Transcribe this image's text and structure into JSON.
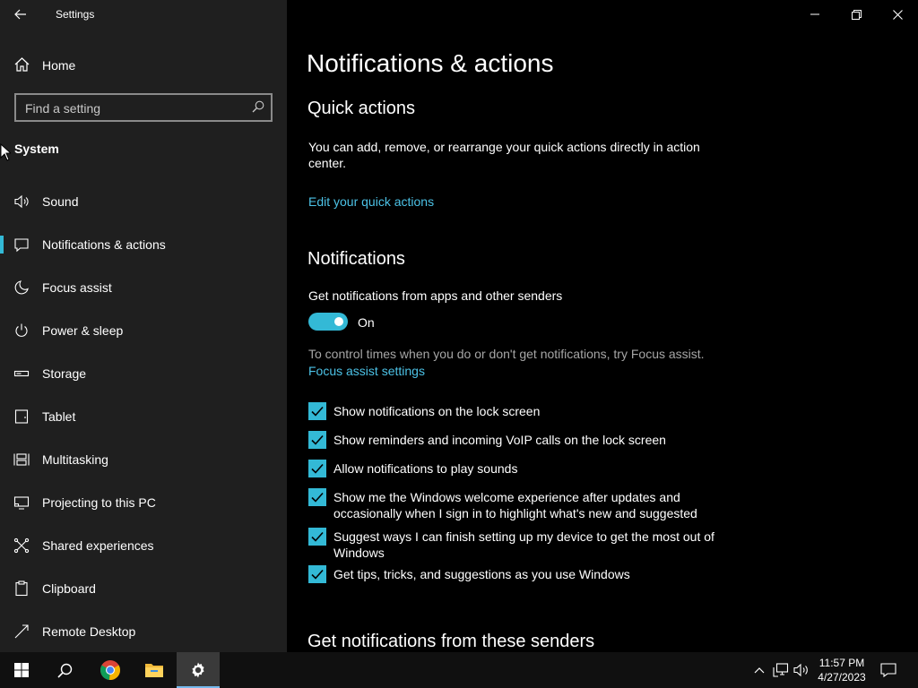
{
  "window": {
    "title": "Settings"
  },
  "sidebar": {
    "home_label": "Home",
    "search_placeholder": "Find a setting",
    "section_title": "System",
    "items": [
      {
        "label": "Sound",
        "icon": "speaker-icon"
      },
      {
        "label": "Notifications & actions",
        "icon": "speech-bubble-icon",
        "selected": true
      },
      {
        "label": "Focus assist",
        "icon": "moon-icon"
      },
      {
        "label": "Power & sleep",
        "icon": "power-icon"
      },
      {
        "label": "Storage",
        "icon": "storage-drive-icon"
      },
      {
        "label": "Tablet",
        "icon": "tablet-icon"
      },
      {
        "label": "Multitasking",
        "icon": "multitasking-icon"
      },
      {
        "label": "Projecting to this PC",
        "icon": "projecting-icon"
      },
      {
        "label": "Shared experiences",
        "icon": "shared-experiences-icon"
      },
      {
        "label": "Clipboard",
        "icon": "clipboard-icon"
      },
      {
        "label": "Remote Desktop",
        "icon": "remote-desktop-icon"
      }
    ]
  },
  "main": {
    "page_title": "Notifications & actions",
    "quick_actions": {
      "heading": "Quick actions",
      "description": "You can add, remove, or rearrange your quick actions directly in action center.",
      "link": "Edit your quick actions"
    },
    "notifications": {
      "heading": "Notifications",
      "toggle_label": "Get notifications from apps and other senders",
      "toggle_state": "On",
      "toggle_on": true,
      "focus_hint": "To control times when you do or don't get notifications, try Focus assist.",
      "focus_link": "Focus assist settings",
      "checkboxes": [
        {
          "label": "Show notifications on the lock screen",
          "checked": true
        },
        {
          "label": "Show reminders and incoming VoIP calls on the lock screen",
          "checked": true
        },
        {
          "label": "Allow notifications to play sounds",
          "checked": true
        },
        {
          "label": "Show me the Windows welcome experience after updates and occasionally when I sign in to highlight what's new and suggested",
          "checked": true
        },
        {
          "label": "Suggest ways I can finish setting up my device to get the most out of Windows",
          "checked": true
        },
        {
          "label": "Get tips, tricks, and suggestions as you use Windows",
          "checked": true
        }
      ]
    },
    "senders_heading": "Get notifications from these senders"
  },
  "taskbar": {
    "time": "11:57 PM",
    "date": "4/27/2023",
    "pinned": [
      "windows-start-icon",
      "search-icon",
      "chrome-icon",
      "file-explorer-icon",
      "settings-gear-icon"
    ],
    "tray": [
      "chevron-up-icon",
      "network-icon",
      "volume-icon",
      "action-center-icon"
    ]
  },
  "colors": {
    "accent": "#33b9d6",
    "link": "#4cc2e6",
    "sidebar_bg": "#1f1f1f",
    "main_bg": "#000000",
    "taskbar_bg": "#101010"
  }
}
